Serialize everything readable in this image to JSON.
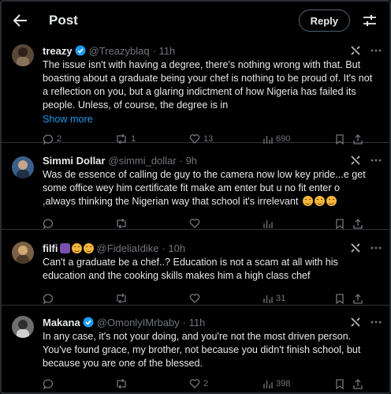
{
  "header": {
    "title": "Post",
    "reply_label": "Reply"
  },
  "tweets": [
    {
      "name": "treazy",
      "handle": "@Treazyblaq",
      "time": "· 11h",
      "verified": true,
      "lines": [
        "The issue isn't with having a degree, there's nothing wrong with that. But",
        "boasting about a graduate being your chef is nothing to be proud of. It's not",
        "a reflection on you, but a glaring indictment of how Nigeria has failed its",
        "people. Unless, of course, the degree is in"
      ],
      "show_more": "Show more",
      "stats": {
        "replies": "2",
        "reposts": "1",
        "likes": "13",
        "views": "690"
      }
    },
    {
      "name": "Simmi Dollar",
      "handle": "@simmi_dollar",
      "time": "· 9h",
      "verified": false,
      "lines": [
        "Was de essence of calling de guy to the camera now low key pride...e get",
        "some office wey him certificate fit make am enter but u no fit enter o",
        ",always thinking the Nigerian way that school it's irrelevant"
      ],
      "stats": {
        "replies": "",
        "reposts": "",
        "likes": "",
        "views": ""
      }
    },
    {
      "name": "filfi",
      "handle": "@FideliaIdike",
      "time": "· 10h",
      "verified": false,
      "lines": [
        "Can't a graduate be a chef..? Education is not a scam at all with his",
        "education and the cooking skills makes him a high class chef"
      ],
      "stats": {
        "replies": "",
        "reposts": "",
        "likes": "",
        "views": "31"
      }
    },
    {
      "name": "Makana",
      "handle": "@OmonlyIMrbaby",
      "time": "· 11h",
      "verified": true,
      "lines": [
        "In any case, it's not your doing, and you're not the most driven person.",
        "You've found grace, my brother, not because you didn't finish school, but",
        "because you are one of the blessed."
      ],
      "stats": {
        "replies": "",
        "reposts": "",
        "likes": "2",
        "views": "398"
      }
    }
  ],
  "colors": {
    "accent": "#1d9bf0",
    "muted": "#71767b",
    "text": "#e7e9ea"
  }
}
